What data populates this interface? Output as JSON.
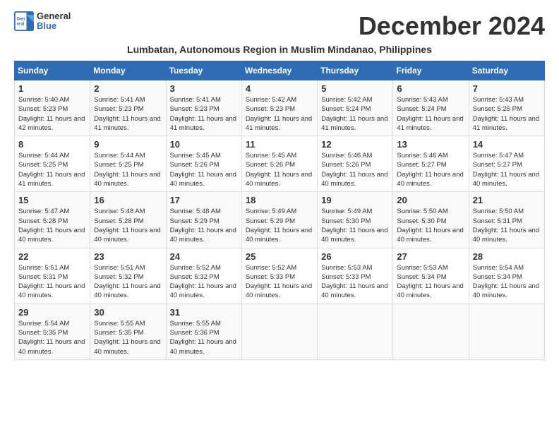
{
  "logo": {
    "general": "General",
    "blue": "Blue"
  },
  "title": "December 2024",
  "subtitle": "Lumbatan, Autonomous Region in Muslim Mindanao, Philippines",
  "headers": [
    "Sunday",
    "Monday",
    "Tuesday",
    "Wednesday",
    "Thursday",
    "Friday",
    "Saturday"
  ],
  "weeks": [
    [
      {
        "day": "1",
        "sunrise": "5:40 AM",
        "sunset": "5:23 PM",
        "daylight": "11 hours and 42 minutes."
      },
      {
        "day": "2",
        "sunrise": "5:41 AM",
        "sunset": "5:23 PM",
        "daylight": "11 hours and 41 minutes."
      },
      {
        "day": "3",
        "sunrise": "5:41 AM",
        "sunset": "5:23 PM",
        "daylight": "11 hours and 41 minutes."
      },
      {
        "day": "4",
        "sunrise": "5:42 AM",
        "sunset": "5:23 PM",
        "daylight": "11 hours and 41 minutes."
      },
      {
        "day": "5",
        "sunrise": "5:42 AM",
        "sunset": "5:24 PM",
        "daylight": "11 hours and 41 minutes."
      },
      {
        "day": "6",
        "sunrise": "5:43 AM",
        "sunset": "5:24 PM",
        "daylight": "11 hours and 41 minutes."
      },
      {
        "day": "7",
        "sunrise": "5:43 AM",
        "sunset": "5:25 PM",
        "daylight": "11 hours and 41 minutes."
      }
    ],
    [
      {
        "day": "8",
        "sunrise": "5:44 AM",
        "sunset": "5:25 PM",
        "daylight": "11 hours and 41 minutes."
      },
      {
        "day": "9",
        "sunrise": "5:44 AM",
        "sunset": "5:25 PM",
        "daylight": "11 hours and 40 minutes."
      },
      {
        "day": "10",
        "sunrise": "5:45 AM",
        "sunset": "5:26 PM",
        "daylight": "11 hours and 40 minutes."
      },
      {
        "day": "11",
        "sunrise": "5:45 AM",
        "sunset": "5:26 PM",
        "daylight": "11 hours and 40 minutes."
      },
      {
        "day": "12",
        "sunrise": "5:46 AM",
        "sunset": "5:26 PM",
        "daylight": "11 hours and 40 minutes."
      },
      {
        "day": "13",
        "sunrise": "5:46 AM",
        "sunset": "5:27 PM",
        "daylight": "11 hours and 40 minutes."
      },
      {
        "day": "14",
        "sunrise": "5:47 AM",
        "sunset": "5:27 PM",
        "daylight": "11 hours and 40 minutes."
      }
    ],
    [
      {
        "day": "15",
        "sunrise": "5:47 AM",
        "sunset": "5:28 PM",
        "daylight": "11 hours and 40 minutes."
      },
      {
        "day": "16",
        "sunrise": "5:48 AM",
        "sunset": "5:28 PM",
        "daylight": "11 hours and 40 minutes."
      },
      {
        "day": "17",
        "sunrise": "5:48 AM",
        "sunset": "5:29 PM",
        "daylight": "11 hours and 40 minutes."
      },
      {
        "day": "18",
        "sunrise": "5:49 AM",
        "sunset": "5:29 PM",
        "daylight": "11 hours and 40 minutes."
      },
      {
        "day": "19",
        "sunrise": "5:49 AM",
        "sunset": "5:30 PM",
        "daylight": "11 hours and 40 minutes."
      },
      {
        "day": "20",
        "sunrise": "5:50 AM",
        "sunset": "5:30 PM",
        "daylight": "11 hours and 40 minutes."
      },
      {
        "day": "21",
        "sunrise": "5:50 AM",
        "sunset": "5:31 PM",
        "daylight": "11 hours and 40 minutes."
      }
    ],
    [
      {
        "day": "22",
        "sunrise": "5:51 AM",
        "sunset": "5:31 PM",
        "daylight": "11 hours and 40 minutes."
      },
      {
        "day": "23",
        "sunrise": "5:51 AM",
        "sunset": "5:32 PM",
        "daylight": "11 hours and 40 minutes."
      },
      {
        "day": "24",
        "sunrise": "5:52 AM",
        "sunset": "5:32 PM",
        "daylight": "11 hours and 40 minutes."
      },
      {
        "day": "25",
        "sunrise": "5:52 AM",
        "sunset": "5:33 PM",
        "daylight": "11 hours and 40 minutes."
      },
      {
        "day": "26",
        "sunrise": "5:53 AM",
        "sunset": "5:33 PM",
        "daylight": "11 hours and 40 minutes."
      },
      {
        "day": "27",
        "sunrise": "5:53 AM",
        "sunset": "5:34 PM",
        "daylight": "11 hours and 40 minutes."
      },
      {
        "day": "28",
        "sunrise": "5:54 AM",
        "sunset": "5:34 PM",
        "daylight": "11 hours and 40 minutes."
      }
    ],
    [
      {
        "day": "29",
        "sunrise": "5:54 AM",
        "sunset": "5:35 PM",
        "daylight": "11 hours and 40 minutes."
      },
      {
        "day": "30",
        "sunrise": "5:55 AM",
        "sunset": "5:35 PM",
        "daylight": "11 hours and 40 minutes."
      },
      {
        "day": "31",
        "sunrise": "5:55 AM",
        "sunset": "5:36 PM",
        "daylight": "11 hours and 40 minutes."
      },
      null,
      null,
      null,
      null
    ]
  ],
  "daylight_label": "Daylight:",
  "sunrise_label": "Sunrise:",
  "sunset_label": "Sunset:"
}
